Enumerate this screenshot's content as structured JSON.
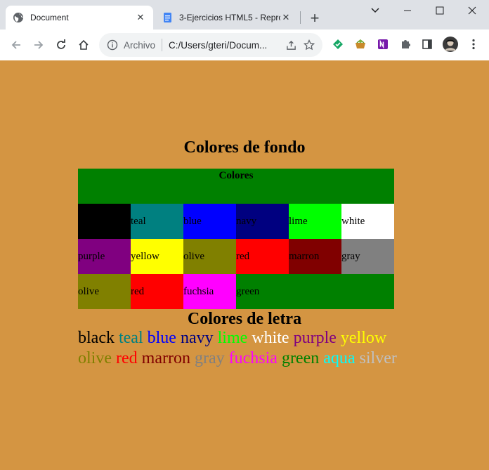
{
  "browser": {
    "tabs": [
      {
        "title": "Document",
        "active": true
      },
      {
        "title": "3-Ejercicios HTML5 - Repro",
        "active": false
      }
    ],
    "new_tab_glyph": "+",
    "address": {
      "scheme": "Archivo",
      "url": "C:/Users/gteri/Docum..."
    },
    "icons": [
      "back-icon",
      "forward-icon",
      "reload-icon",
      "home-icon",
      "info-icon",
      "share-icon",
      "star-icon",
      "extension-green-icon",
      "extension-basket-icon",
      "onenote-icon",
      "puzzle-icon",
      "sidepanel-icon",
      "profile-avatar",
      "more-menu-icon"
    ]
  },
  "page": {
    "bg_heading": "Colores de fondo",
    "table": {
      "caption": "Colores",
      "rows": [
        [
          {
            "label": "black",
            "color": "#000000"
          },
          {
            "label": "teal",
            "color": "#008080"
          },
          {
            "label": "blue",
            "color": "#0000ff"
          },
          {
            "label": "navy",
            "color": "#000080"
          },
          {
            "label": "lime",
            "color": "#00ff00"
          },
          {
            "label": "white",
            "color": "#ffffff"
          }
        ],
        [
          {
            "label": "purple",
            "color": "#800080"
          },
          {
            "label": "yellow",
            "color": "#ffff00"
          },
          {
            "label": "olive",
            "color": "#808000"
          },
          {
            "label": "red",
            "color": "#ff0000"
          },
          {
            "label": "marron",
            "color": "#800000"
          },
          {
            "label": "gray",
            "color": "#808080"
          }
        ],
        [
          {
            "label": "olive",
            "color": "#808000"
          },
          {
            "label": "red",
            "color": "#ff0000"
          },
          {
            "label": "fuchsia",
            "color": "#ff00ff"
          },
          {
            "label": "green",
            "color": "#008000"
          }
        ]
      ],
      "table_bg": "#008000"
    },
    "text_heading": "Colores de letra",
    "text_colors": [
      [
        {
          "label": "black",
          "color": "#000000"
        },
        {
          "label": "teal",
          "color": "#008080"
        },
        {
          "label": "blue",
          "color": "#0000ff"
        },
        {
          "label": "navy",
          "color": "#000080"
        },
        {
          "label": "lime",
          "color": "#00ff00"
        },
        {
          "label": "white",
          "color": "#ffffff"
        },
        {
          "label": "purple",
          "color": "#800080"
        },
        {
          "label": "yellow",
          "color": "#ffff00"
        }
      ],
      [
        {
          "label": "olive",
          "color": "#808000"
        },
        {
          "label": "red",
          "color": "#ff0000"
        },
        {
          "label": "marron",
          "color": "#800000"
        },
        {
          "label": "gray",
          "color": "#808080"
        },
        {
          "label": "fuchsia",
          "color": "#ff00ff"
        },
        {
          "label": "green",
          "color": "#008000"
        },
        {
          "label": "aqua",
          "color": "#00ffff"
        },
        {
          "label": "silver",
          "color": "#c0c0c0"
        }
      ]
    ],
    "page_bg": "#d49542"
  }
}
